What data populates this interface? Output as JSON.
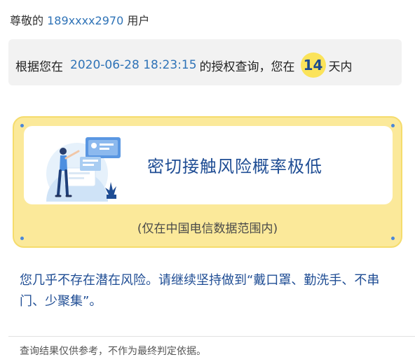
{
  "greeting": {
    "prefix": "尊敬的",
    "phone": "189xxxx2970",
    "suffix": "用户"
  },
  "query": {
    "prefix": "根据您在",
    "timestamp": "2020-06-28 18:23:15",
    "middle": "的授权查询，您在",
    "days": "14",
    "suffix": "天内"
  },
  "result": {
    "title": "密切接触风险概率极低",
    "scope_note": "(仅在中国电信数据范围内)",
    "illustration_icon": "person-presenting-board-illustration"
  },
  "advice": "您几乎不存在潜在风险。请继续坚持做到“戴口罩、勤洗手、不串门、少聚集”。",
  "disclaimer": "查询结果仅供参考，不作为最终判定依据。",
  "colors": {
    "accent_blue": "#1f4d94",
    "link_blue": "#2f73b7",
    "card_yellow": "#fbe99a",
    "badge_yellow": "#fbe35a"
  }
}
